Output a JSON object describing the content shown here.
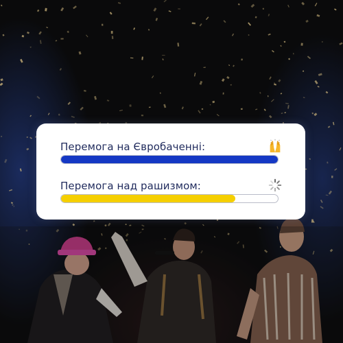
{
  "card": {
    "rows": [
      {
        "label": "Перемога на Євробаченні:",
        "progress": 1.0,
        "bar_color": "#1538c4",
        "icon": "raised-hands-icon"
      },
      {
        "label": "Перемога над рашизмом:",
        "progress": 0.805,
        "bar_color": "#f5cf00",
        "icon": "loading-spinner-icon"
      }
    ]
  },
  "colors": {
    "card_background": "#ffffff",
    "label_text": "#1f2a5c",
    "background": "#0a0a0b",
    "confetti": "#c9b27a"
  }
}
